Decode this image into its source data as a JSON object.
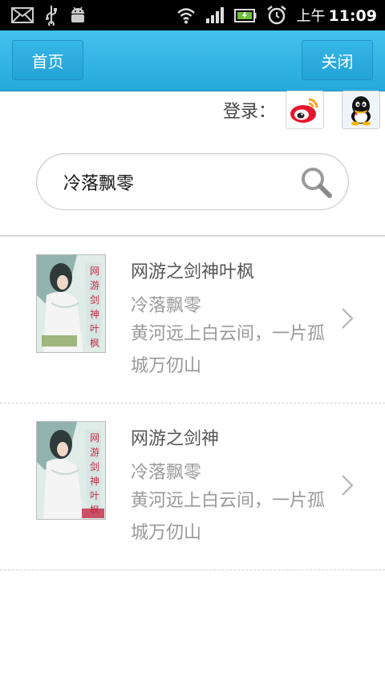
{
  "status_bar": {
    "ampm": "上午",
    "time": "11:09",
    "icons": [
      "mail-icon",
      "usb-icon",
      "android-debug-icon",
      "wifi-icon",
      "signal-icon",
      "battery-icon",
      "alarm-icon"
    ]
  },
  "header": {
    "home_label": "首页",
    "close_label": "关闭",
    "bg_color": "#2daedf"
  },
  "login": {
    "label": "登录：",
    "providers": [
      "weibo-icon",
      "qq-icon"
    ]
  },
  "search": {
    "value": "冷落飘零",
    "icon": "search-icon"
  },
  "results": [
    {
      "title": "网游之剑神叶枫",
      "author": "冷落飘零",
      "description": "黄河远上白云间，一片孤城万仞山"
    },
    {
      "title": "网游之剑神",
      "author": "冷落飘零",
      "description": "黄河远上白云间，一片孤城万仞山"
    }
  ]
}
